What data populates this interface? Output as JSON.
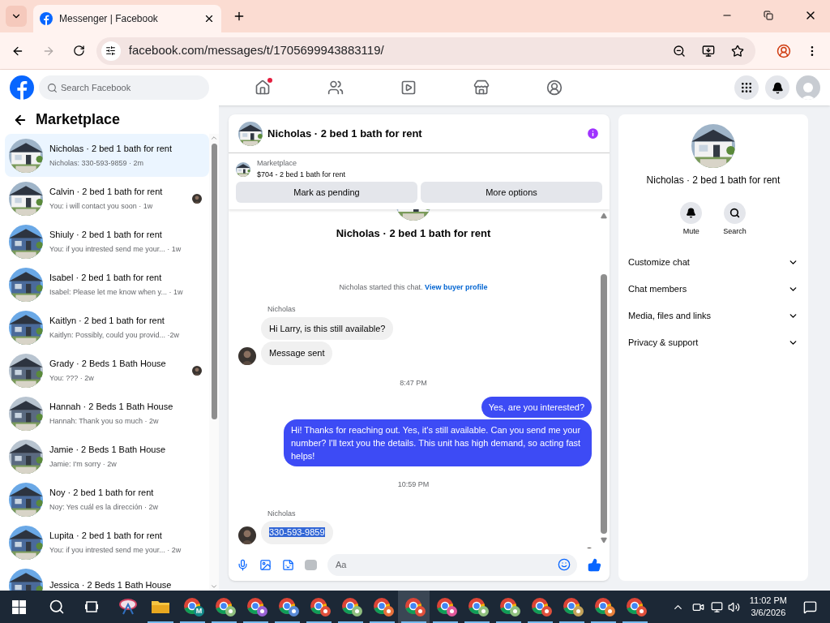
{
  "browser": {
    "tab_title": "Messenger | Facebook",
    "url": "facebook.com/messages/t/1705699943883119/"
  },
  "header": {
    "search_placeholder": "Search Facebook",
    "home_notification": true
  },
  "sidebar": {
    "title": "Marketplace",
    "conversations": [
      {
        "name": "Nicholas · 2 bed 1 bath for rent",
        "preview": "Nicholas: 330-593-9859 · 2m",
        "selected": true,
        "seen": false
      },
      {
        "name": "Calvin · 2 bed 1 bath for rent",
        "preview": "You: i will contact you soon · 1w",
        "selected": false,
        "seen": true
      },
      {
        "name": "Shiuly · 2 bed 1 bath for rent",
        "preview": "You: if you intrested send me your... · 1w",
        "selected": false,
        "seen": false
      },
      {
        "name": "Isabel · 2 bed 1 bath for rent",
        "preview": "Isabel: Please let me know when y... · 1w",
        "selected": false,
        "seen": false
      },
      {
        "name": "Kaitlyn · 2 bed 1 bath for rent",
        "preview": "Kaitlyn: Possibly, could you provid... ·2w",
        "selected": false,
        "seen": false
      },
      {
        "name": "Grady · 2 Beds 1 Bath House",
        "preview": "You: ??? · 2w",
        "selected": false,
        "seen": true
      },
      {
        "name": "Hannah · 2 Beds 1 Bath House",
        "preview": "Hannah: Thank you so much · 2w",
        "selected": false,
        "seen": false
      },
      {
        "name": "Jamie · 2 Beds 1 Bath House",
        "preview": "Jamie: I'm sorry · 2w",
        "selected": false,
        "seen": false
      },
      {
        "name": "Noy · 2 bed 1 bath for rent",
        "preview": "Noy: Yes cuál es la dirección · 2w",
        "selected": false,
        "seen": false
      },
      {
        "name": "Lupita · 2 bed 1 bath for rent",
        "preview": "You: if you intrested send me your... · 2w",
        "selected": false,
        "seen": false
      },
      {
        "name": "Jessica · 2 Beds 1 Bath House",
        "selected": false,
        "seen": false
      }
    ]
  },
  "chat": {
    "title": "Nicholas · 2 bed 1 bath for rent",
    "listing_label": "Marketplace",
    "listing": "$704 - 2 bed 1 bath for rent",
    "buttons": [
      "Mark as pending",
      "More options"
    ],
    "intro_title": "Nicholas · 2 bed 1 bath for rent",
    "messages": [
      {
        "kind": "system",
        "text": "Nicholas started this chat.",
        "link": "View buyer profile"
      },
      {
        "kind": "sender",
        "text": "Nicholas"
      },
      {
        "kind": "incoming",
        "text": "Hi Larry, is this still available?",
        "avatar": false,
        "highlighted": false
      },
      {
        "kind": "incoming",
        "text": "Message sent",
        "avatar": true,
        "highlighted": false
      },
      {
        "kind": "time",
        "text": "8:47 PM"
      },
      {
        "kind": "outgoing",
        "text": "Yes, are you interested?"
      },
      {
        "kind": "outgoing",
        "text": "Hi!  Thanks for reaching out.  Yes, it's still available.  Can you send me your number? I'll  text you the details.  This unit has high demand, so acting fast helps!"
      },
      {
        "kind": "time",
        "text": "10:59 PM"
      },
      {
        "kind": "sender",
        "text": "Nicholas"
      },
      {
        "kind": "incoming",
        "text": "330-593-9859",
        "avatar": true,
        "highlighted": true
      }
    ],
    "composer_placeholder": "Aa"
  },
  "details": {
    "title": "Nicholas · 2 bed 1 bath for rent",
    "actions": [
      {
        "kind": "mute",
        "label": "Mute"
      },
      {
        "kind": "search",
        "label": "Search"
      }
    ],
    "sections": [
      "Customize chat",
      "Chat members",
      "Media, files and links",
      "Privacy & support"
    ]
  },
  "taskbar": {
    "apps": [
      {
        "kind": "snip",
        "running": false,
        "selected": false
      },
      {
        "kind": "files",
        "running": true,
        "selected": false
      },
      {
        "kind": "chrome",
        "badge_text": "M",
        "color": "#138a8a",
        "running": true,
        "selected": false
      },
      {
        "kind": "chrome",
        "color": "#8fbf7f",
        "running": true,
        "selected": false
      },
      {
        "kind": "chrome",
        "color": "#9a62d6",
        "running": true,
        "selected": false
      },
      {
        "kind": "chrome",
        "color": "#5a8ad6",
        "running": true,
        "selected": false
      },
      {
        "kind": "chrome",
        "color": "#e0503c",
        "running": true,
        "selected": false
      },
      {
        "kind": "chrome",
        "color": "#8fbf7f",
        "running": true,
        "selected": false
      },
      {
        "kind": "chrome",
        "color": "#e8703a",
        "running": true,
        "selected": false
      },
      {
        "kind": "chrome",
        "color": "#e0503c",
        "running": true,
        "selected": true
      },
      {
        "kind": "chrome",
        "color": "#e0589a",
        "running": true,
        "selected": false
      },
      {
        "kind": "chrome",
        "color": "#8fbf7f",
        "running": true,
        "selected": false
      },
      {
        "kind": "chrome",
        "color": "#8fbf7f",
        "running": true,
        "selected": false
      },
      {
        "kind": "chrome",
        "color": "#e0503c",
        "running": true,
        "selected": false
      },
      {
        "kind": "chrome",
        "color": "#c4a35a",
        "running": true,
        "selected": false
      },
      {
        "kind": "chrome",
        "color": "#e8803a",
        "running": true,
        "selected": false
      },
      {
        "kind": "chrome",
        "color": "#e0503c",
        "running": true,
        "selected": false
      }
    ],
    "time": "11:02 PM",
    "date": "3/6/2026"
  }
}
